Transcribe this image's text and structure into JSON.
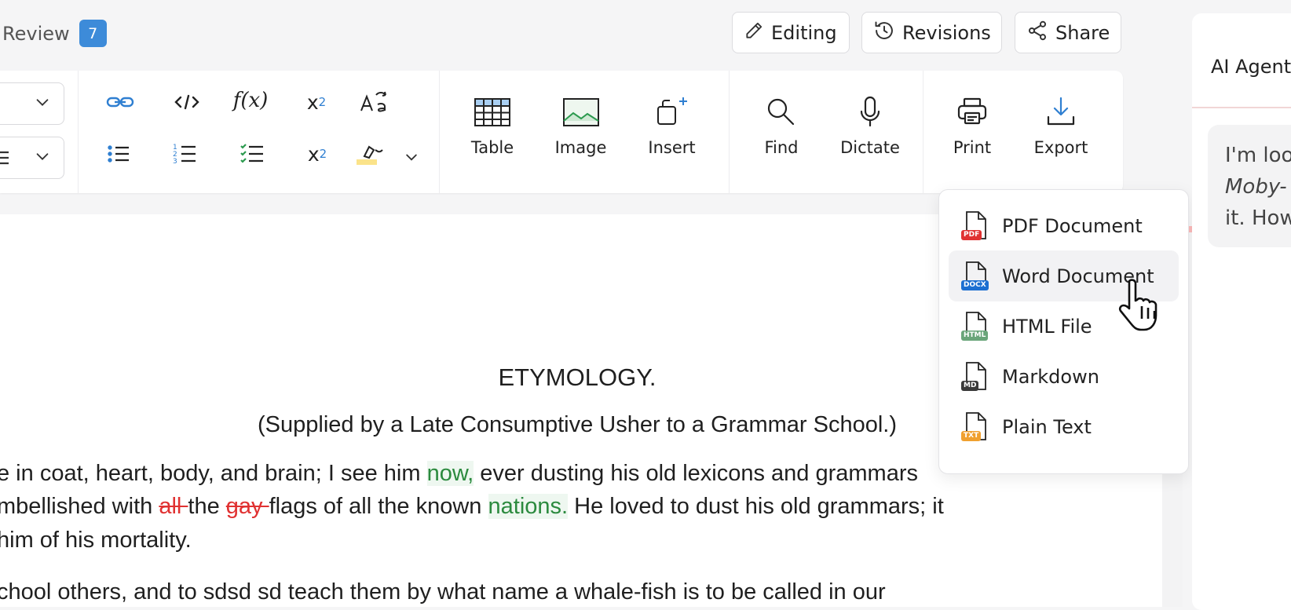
{
  "header": {
    "review_label": "Review",
    "review_count": "7",
    "editing_label": "Editing",
    "revisions_label": "Revisions",
    "share_label": "Share"
  },
  "toolbar": {
    "row1_icons": [
      "link-icon",
      "code-icon",
      "function-icon",
      "superscript-icon",
      "text-case-icon"
    ],
    "row2_icons": [
      "bullet-list-icon",
      "numbered-list-icon",
      "checklist-icon",
      "subscript-icon",
      "highlight-icon"
    ],
    "function_glyph": "f(x)",
    "superscript_glyph": "x",
    "superscript_exp": "2",
    "subscript_glyph": "x",
    "subscript_sub": "2",
    "table_label": "Table",
    "image_label": "Image",
    "insert_label": "Insert",
    "find_label": "Find",
    "dictate_label": "Dictate",
    "print_label": "Print",
    "export_label": "Export"
  },
  "document": {
    "heading": "ETYMOLOGY.",
    "subheading": "(Supplied by a Late Consumptive Usher to a Grammar School.)",
    "line1": {
      "a": "e in coat, heart, body, and brain; I see him ",
      "ins1": "now,",
      "b": " ever dusting his old lexicons and grammars"
    },
    "line2": {
      "a": "mbellished with ",
      "del1": "all ",
      "b": "the ",
      "del2": "gay ",
      "c": "flags of all the known ",
      "ins1": "nations.",
      "d": " He loved to dust his old grammars; it"
    },
    "line3": "him of his mortality.",
    "line4": "chool others, and to sdsd sd teach them by what name a whale-fish is to be called in our"
  },
  "export_menu": {
    "items": [
      {
        "label": "PDF Document",
        "tag": "PDF",
        "color": "#e03131",
        "hover": false
      },
      {
        "label": "Word Document",
        "tag": "DOCX",
        "color": "#1c6fd1",
        "hover": true
      },
      {
        "label": "HTML File",
        "tag": "HTML",
        "color": "#6aa57a",
        "hover": false
      },
      {
        "label": "Markdown",
        "tag": "MD",
        "color": "#3a3a3a",
        "hover": false
      },
      {
        "label": "Plain Text",
        "tag": "TXT",
        "color": "#f0a030",
        "hover": false
      }
    ]
  },
  "right_panel": {
    "title": "AI Agent",
    "message_lines": [
      "I'm loo",
      "Moby-",
      "it. How"
    ]
  },
  "colors": {
    "accent": "#3d8bd9",
    "insert_green": "#2b8a3e",
    "delete_red": "#e03131"
  }
}
